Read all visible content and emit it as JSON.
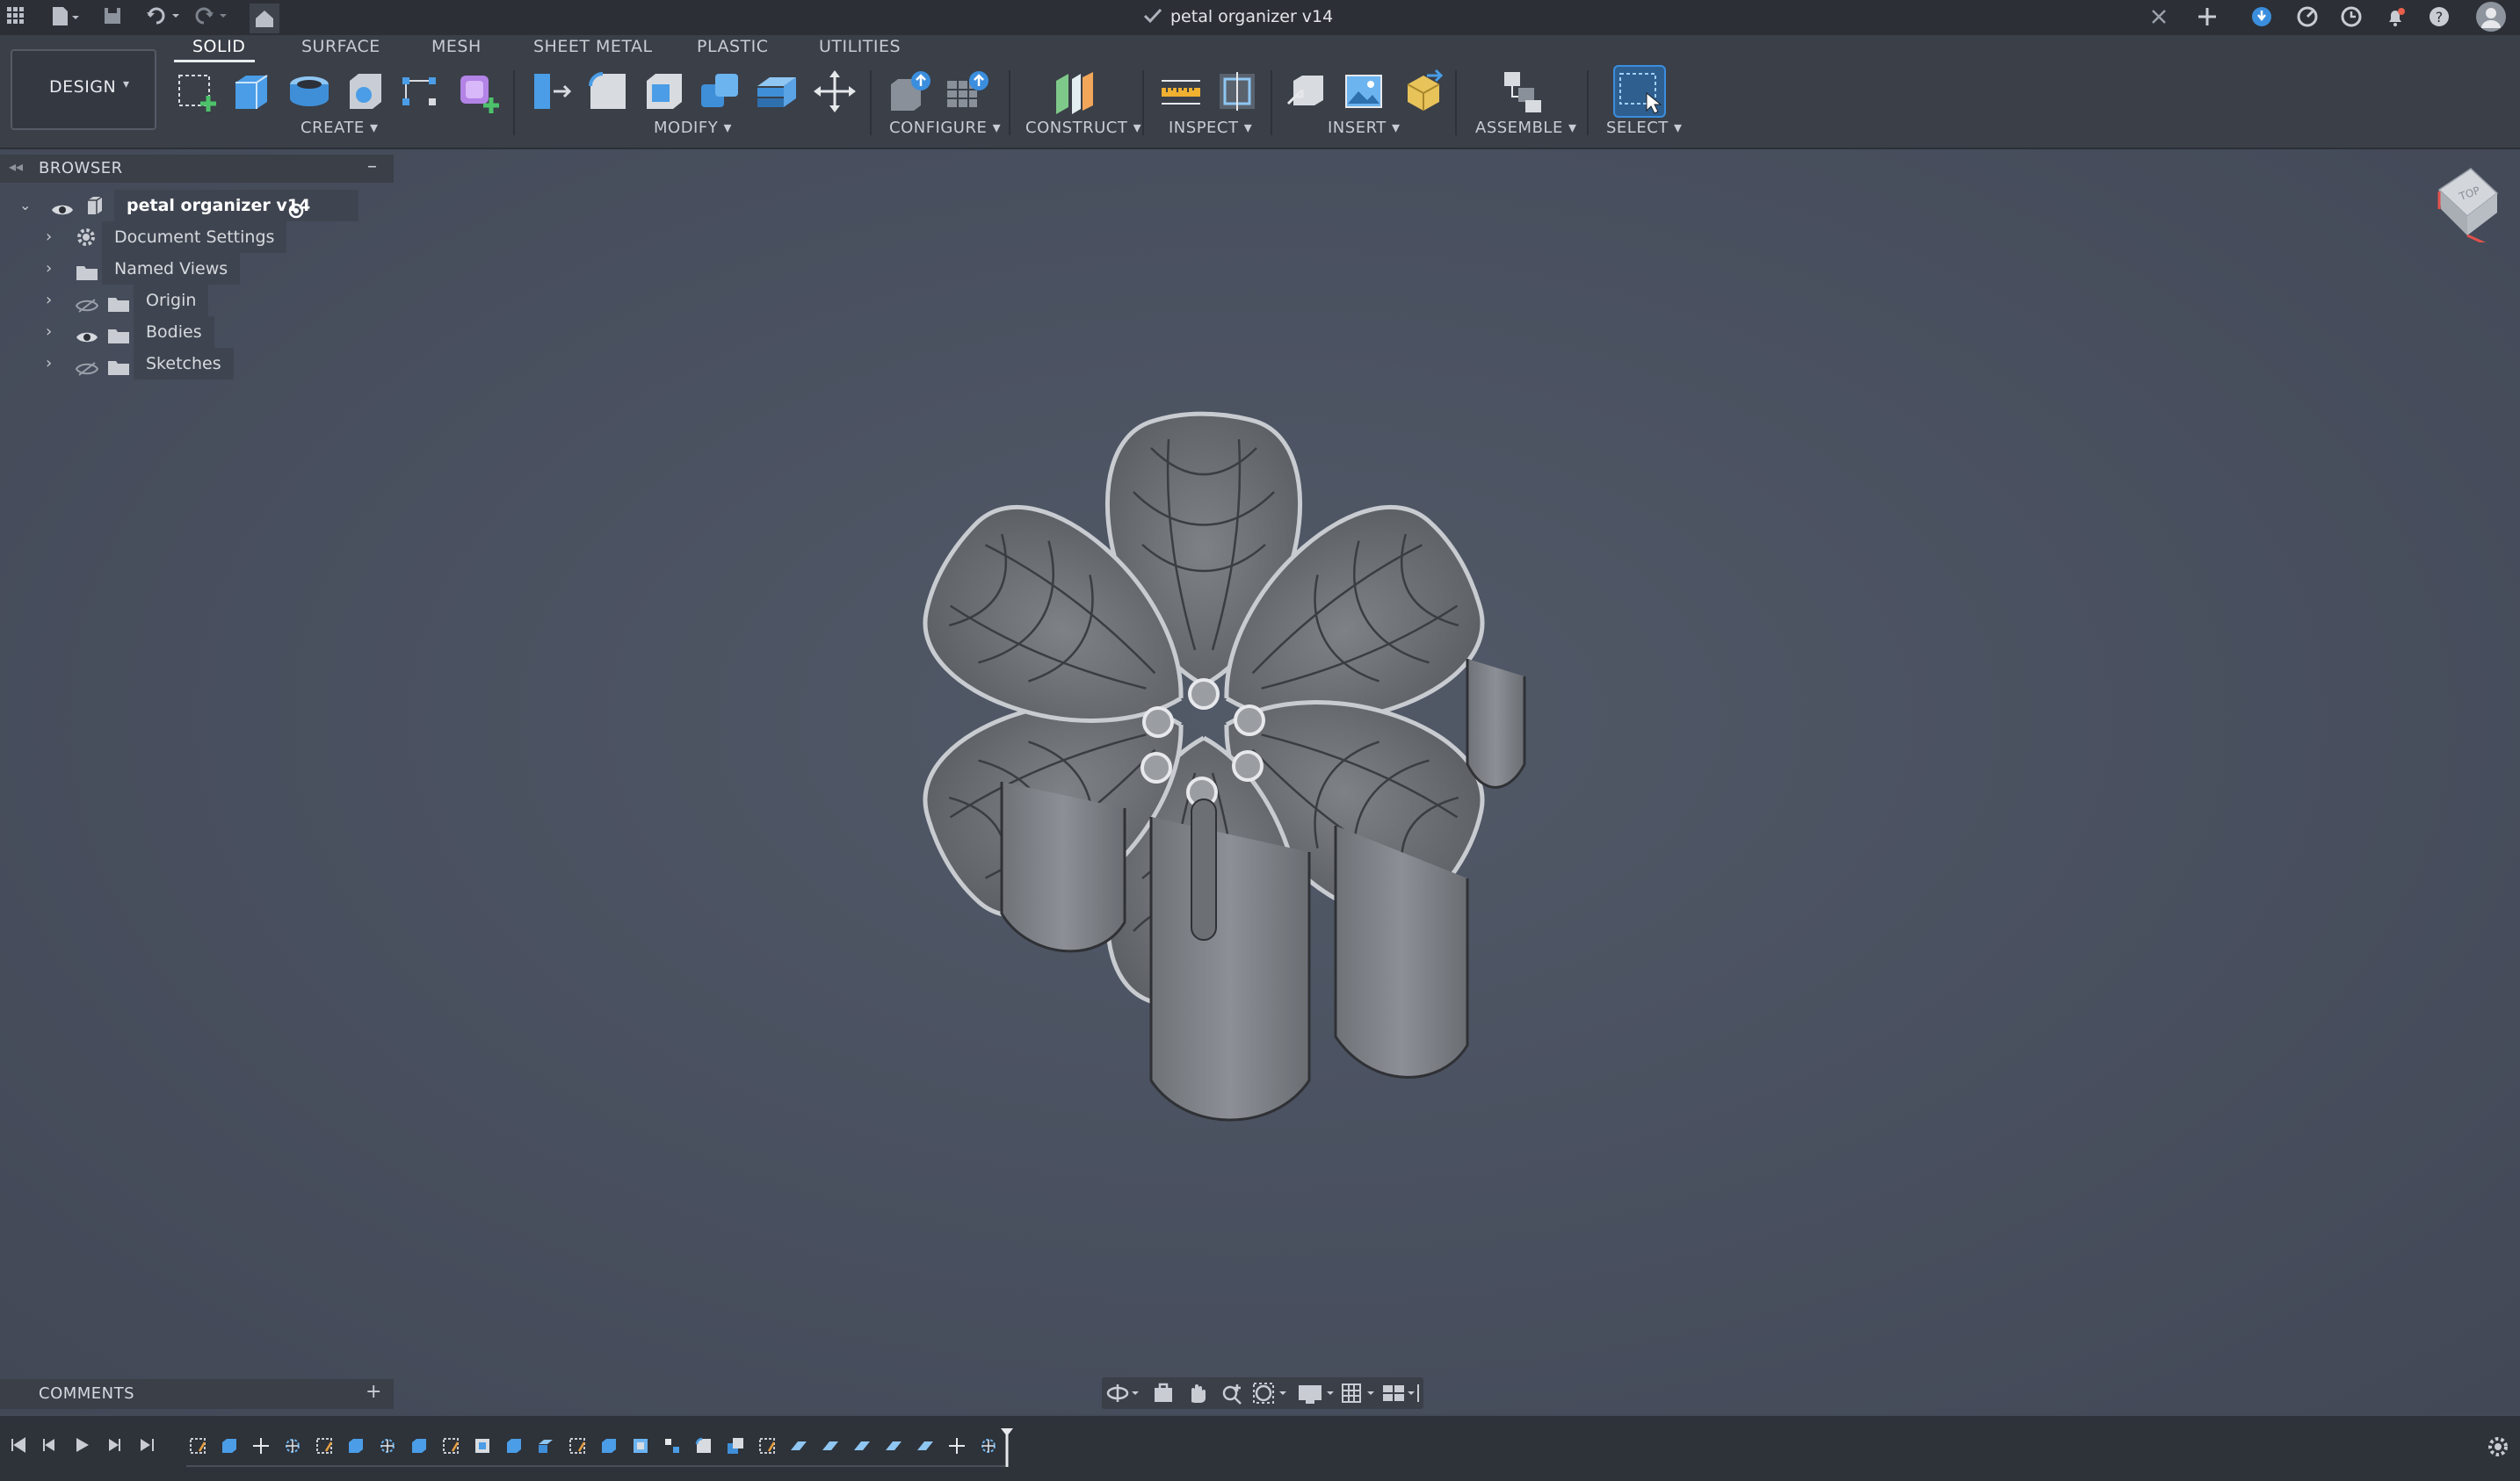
{
  "titlebar": {
    "doc_title": "petal organizer v14"
  },
  "toolbar": {
    "workspace": "DESIGN",
    "tabs": [
      "SOLID",
      "SURFACE",
      "MESH",
      "SHEET METAL",
      "PLASTIC",
      "UTILITIES"
    ],
    "groups": [
      "CREATE",
      "MODIFY",
      "CONFIGURE",
      "CONSTRUCT",
      "INSPECT",
      "INSERT",
      "ASSEMBLE",
      "SELECT"
    ]
  },
  "browser": {
    "title": "BROWSER",
    "root": "petal organizer v14",
    "items": [
      "Document Settings",
      "Named Views",
      "Origin",
      "Bodies",
      "Sketches"
    ]
  },
  "comments": {
    "title": "COMMENTS"
  },
  "viewcube": {
    "face": "TOP"
  },
  "colors": {
    "accent": "#3b8ede",
    "viewport_bg": "#464d5b",
    "panel_bg": "#3a3f48"
  }
}
